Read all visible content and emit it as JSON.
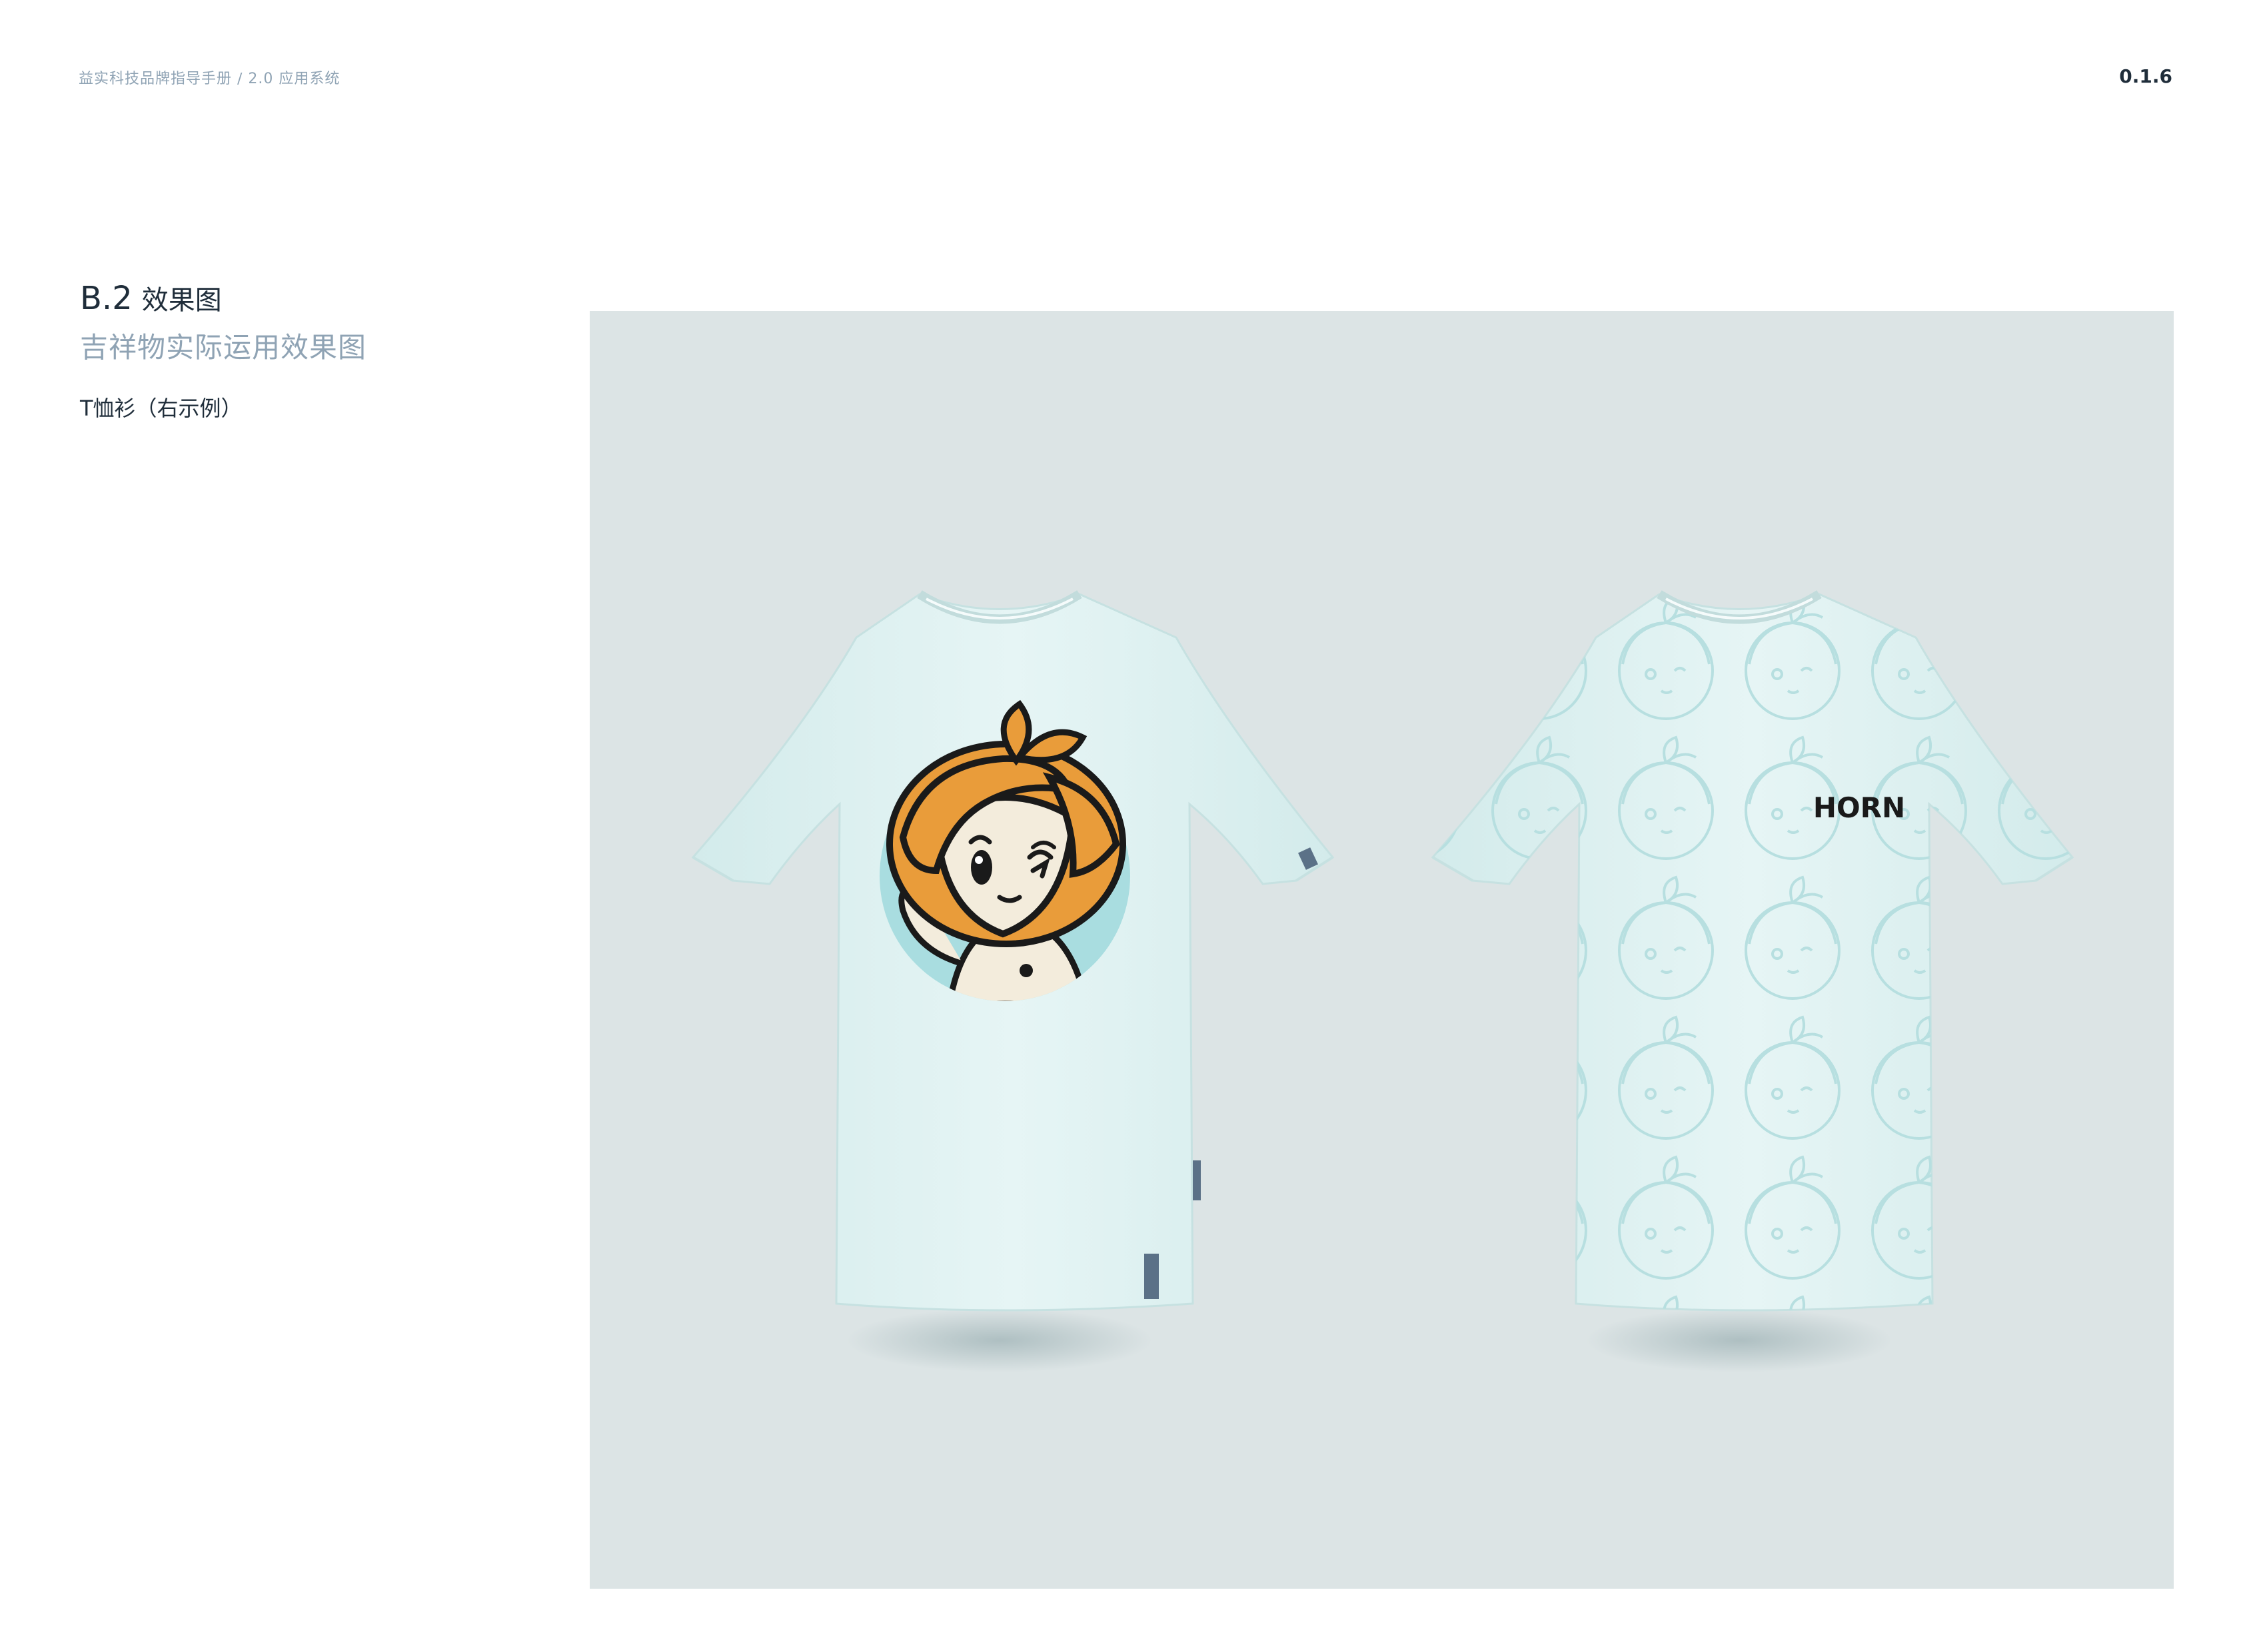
{
  "header": {
    "breadcrumb": "益实科技品牌指导手册 ∕ 2.0 应用系统",
    "page_number": "0.1.6"
  },
  "section": {
    "code": "B.2",
    "title": "效果图",
    "subtitle": "吉祥物实际运用效果图",
    "caption": "T恤衫（右示例）"
  },
  "mockup": {
    "back_logo_text": "HORN",
    "colors": {
      "background": "#dce4e5",
      "shirt": "#dff2f2",
      "circle": "#a9dde0",
      "hair": "#e99c3a",
      "skin": "#f3ecdc",
      "outline": "#1a1a1a",
      "label": "#5b7187"
    }
  }
}
